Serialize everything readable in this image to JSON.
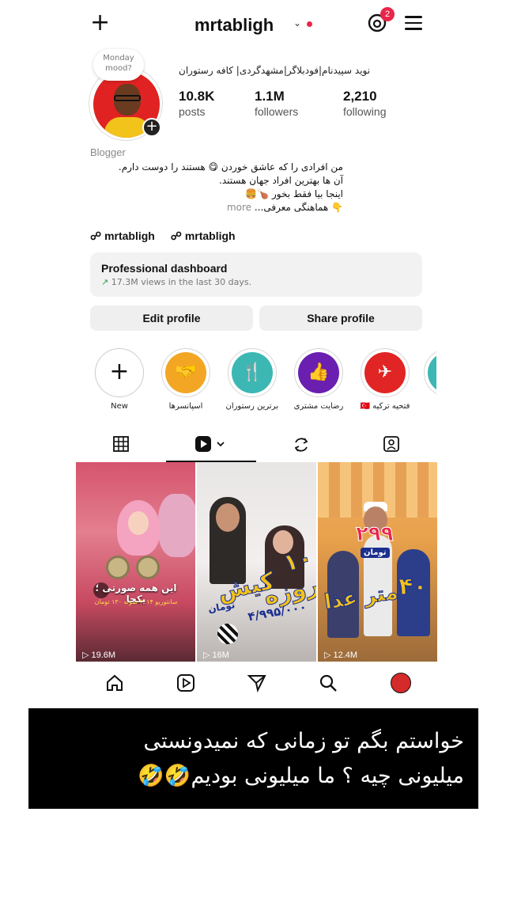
{
  "header": {
    "username": "mrtabligh",
    "badge_count": "2"
  },
  "profile": {
    "note": "Monday mood?",
    "full_name": "نوید سپیدنام|فودبلاگر|مشهدگردی| کافه رستوران",
    "stats": {
      "posts_num": "10.8K",
      "posts_label": "posts",
      "followers_num": "1.1M",
      "followers_label": "followers",
      "following_num": "2,210",
      "following_label": "following"
    },
    "category": "Blogger",
    "bio_line1": "من افرادی را که عاشق خوردن 😋 هستند را دوست دارم.",
    "bio_line2": "آن ها بهترین افراد جهان هستند.",
    "bio_line3": "اینجا بیا فقط بخور 🍗🍔",
    "bio_line4": "👇 هماهنگی معرفی...",
    "bio_more": "more",
    "link1": "mrtabligh",
    "link2": "mrtabligh"
  },
  "dashboard": {
    "title": "Professional dashboard",
    "subtitle": "17.3M views in the last 30 days."
  },
  "buttons": {
    "edit": "Edit profile",
    "share": "Share profile"
  },
  "highlights": [
    {
      "label": "New"
    },
    {
      "label": "اسپانسرها"
    },
    {
      "label": "برترین رستوران"
    },
    {
      "label": "رضایت مشتری"
    },
    {
      "label": "فتحیه ترکیه 🇹🇷"
    }
  ],
  "grid": [
    {
      "views": "19.6M",
      "caption": "این همه صورتی ؛ یکجا",
      "subcaption": "سانتوریو ۲۰۱۴ نمونه ۱۳۰ تومان"
    },
    {
      "views": "16M",
      "t1": "۱۰ روزه",
      "t2": "کیش",
      "t3": "۴/۹۹۵/۰۰۰",
      "t4": "تومان"
    },
    {
      "views": "12.4M",
      "n299": "۲۹۹",
      "toman": "تومان",
      "n40": "۴۰",
      "ghaza": "متر غذا"
    }
  ],
  "caption": {
    "line1": "خواستم بگم تو زمانی که نمیدونستی",
    "line2": "میلیونی چیه ؟ ما میلیونی بودیم🤣🤣"
  },
  "colors": {
    "accent_red": "#e8254a",
    "caption_bg": "#000000"
  }
}
